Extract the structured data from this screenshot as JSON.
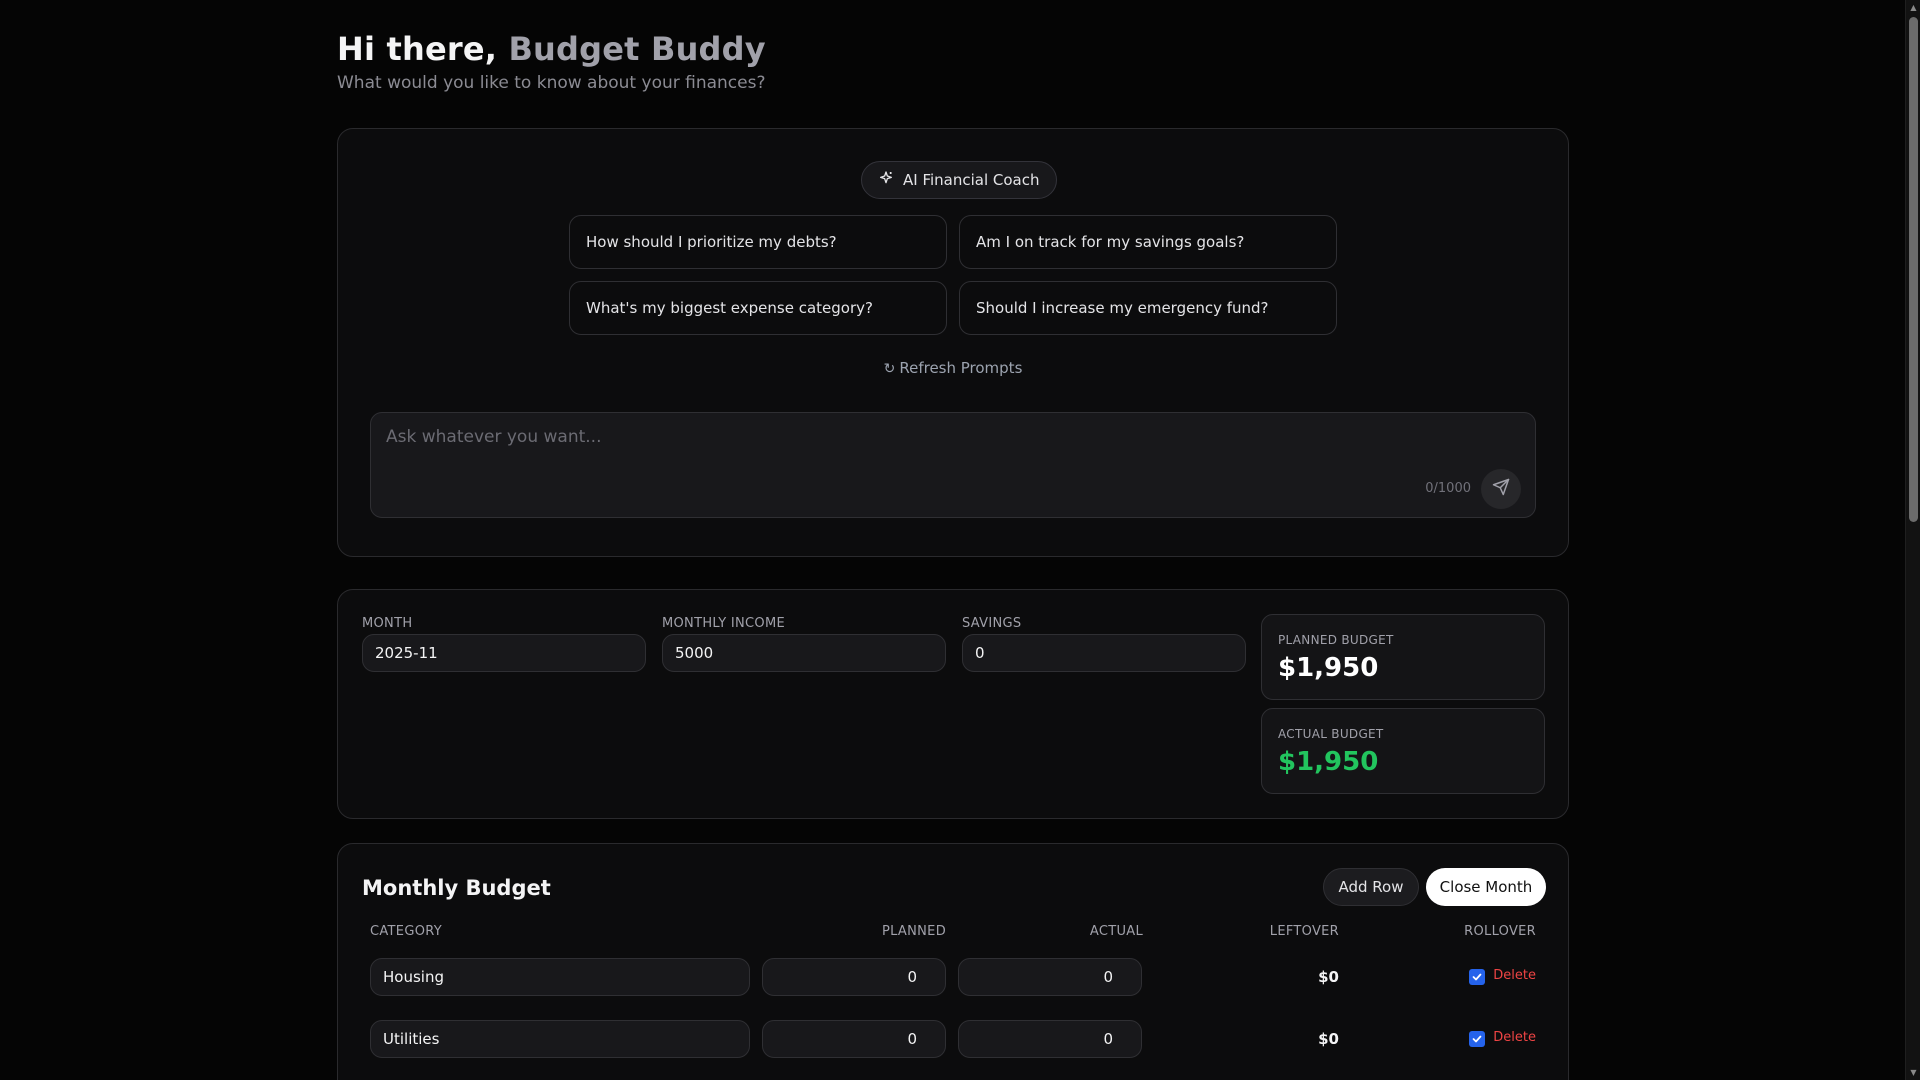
{
  "header": {
    "greeting": "Hi there, ",
    "name": "Budget Buddy",
    "subtitle": "What would you like to know about your finances?"
  },
  "coach": {
    "badge_label": "AI Financial Coach",
    "badge_icon": "sparkle-icon",
    "prompts": [
      "How should I prioritize my debts?",
      "Am I on track for my savings goals?",
      "What's my biggest expense category?",
      "Should I increase my emergency fund?"
    ],
    "refresh_label": "Refresh Prompts",
    "ask_placeholder": "Ask whatever you want...",
    "char_counter": "0/1000"
  },
  "settings": {
    "month_label": "MONTH",
    "month_value": "2025-11",
    "income_label": "MONTHLY INCOME",
    "income_value": "5000",
    "savings_label": "SAVINGS",
    "savings_value": "0",
    "planned_label": "PLANNED BUDGET",
    "planned_value": "$1,950",
    "actual_label": "ACTUAL BUDGET",
    "actual_value": "$1,950"
  },
  "budget": {
    "title": "Monthly Budget",
    "add_row_label": "Add Row",
    "close_month_label": "Close Month",
    "columns": [
      "CATEGORY",
      "PLANNED",
      "ACTUAL",
      "LEFTOVER",
      "ROLLOVER"
    ],
    "rows": [
      {
        "category": "Housing",
        "planned": "0",
        "actual": "0",
        "leftover": "$0",
        "rollover": true,
        "delete_label": "Delete"
      },
      {
        "category": "Utilities",
        "planned": "0",
        "actual": "0",
        "leftover": "$0",
        "rollover": true,
        "delete_label": "Delete"
      }
    ]
  },
  "colors": {
    "background": "#050505",
    "card": "#0c0c0d",
    "accent_green": "#22c55e",
    "danger_red": "#ef4444",
    "checkbox_blue": "#2563eb"
  }
}
